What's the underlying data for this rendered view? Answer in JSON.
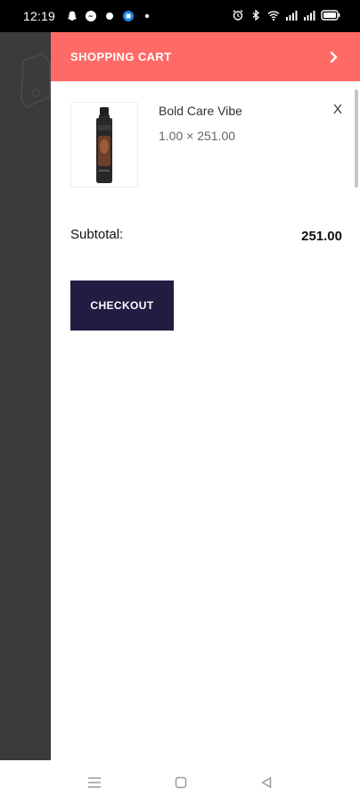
{
  "status_bar": {
    "time": "12:19",
    "left_icons": [
      "snapchat-icon",
      "messenger-icon",
      "notification-dot-icon",
      "app-badge-icon",
      "small-dot-icon"
    ],
    "right_icons": [
      "alarm-icon",
      "bluetooth-icon",
      "wifi-icon",
      "signal-icon",
      "signal-icon",
      "battery-icon"
    ]
  },
  "drawer": {
    "title": "SHOPPING CART",
    "close_icon": "chevron-right-icon",
    "accent_color": "#ff6a66"
  },
  "cart": {
    "items": [
      {
        "name": "Bold Care Vibe",
        "qty_price": "1.00 × 251.00",
        "remove_label": "X",
        "thumbnail": "product-bottle-image"
      }
    ],
    "subtotal_label": "Subtotal:",
    "subtotal_value": "251.00",
    "checkout_label": "CHECKOUT",
    "checkout_color": "#221c43"
  },
  "nav_bar": {
    "buttons": [
      "menu-icon",
      "home-square-icon",
      "back-triangle-icon"
    ]
  }
}
